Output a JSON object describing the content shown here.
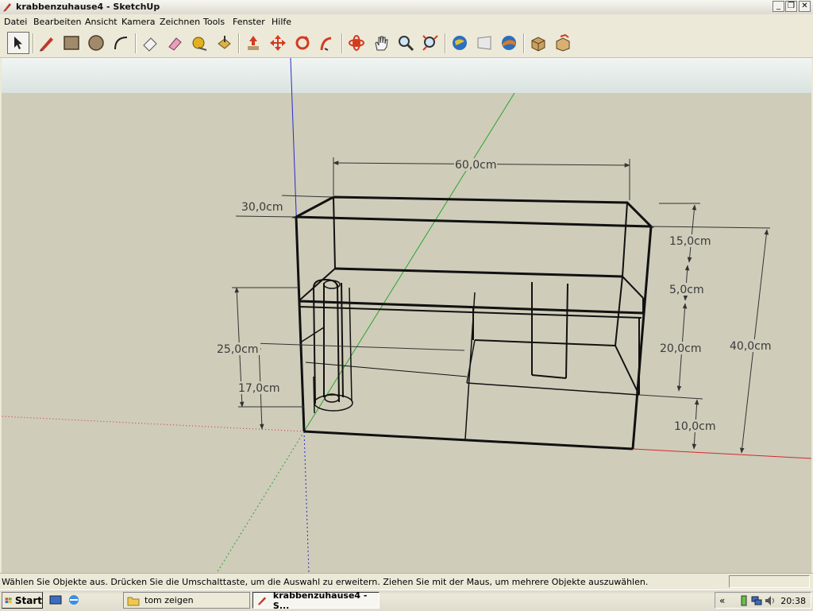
{
  "window": {
    "title": "krabbenzuhause4 - SketchUp",
    "controls": [
      "minimize-icon",
      "restore-icon",
      "close-icon"
    ]
  },
  "menu": [
    "Datei",
    "Bearbeiten",
    "Ansicht",
    "Kamera",
    "Zeichnen",
    "Tools",
    "Fenster",
    "Hilfe"
  ],
  "toolbar": {
    "tools": [
      "select-icon",
      "pencil-icon",
      "rectangle-icon",
      "circle-icon",
      "arc-icon",
      "eraser-icon",
      "paint-bucket-icon",
      "tape-measure-icon",
      "push-pull-icon",
      "move-icon",
      "rotate-icon",
      "follow-me-icon",
      "orbit-icon",
      "pan-icon",
      "zoom-icon",
      "zoom-extents-icon",
      "get-models-icon",
      "share-model-icon",
      "google-earth-icon",
      "components-icon",
      "warehouse-icon"
    ],
    "selected": "select-icon"
  },
  "dimensions": {
    "width": "60,0cm",
    "depth": "30,0cm",
    "d15": "15,0cm",
    "d5": "5,0cm",
    "d20": "20,0cm",
    "d40": "40,0cm",
    "d25": "25,0cm",
    "d17": "17,0cm",
    "d10": "10,0cm"
  },
  "colors": {
    "sky": "#e3e9e6",
    "ground": "#cfccba",
    "axis_red": "#d22a2a",
    "axis_green": "#2aa52a",
    "axis_blue": "#2a2ac8"
  },
  "status": {
    "hint": "Wählen Sie Objekte aus. Drücken Sie die Umschalttaste, um die Auswahl zu erweitern. Ziehen Sie mit der Maus, um mehrere Objekte auszuwählen."
  },
  "taskbar": {
    "start": "Start",
    "tasks": [
      "tom zeigen",
      "krabbenzuhause4 - S..."
    ],
    "clock": "20:38",
    "chevron": "«"
  }
}
